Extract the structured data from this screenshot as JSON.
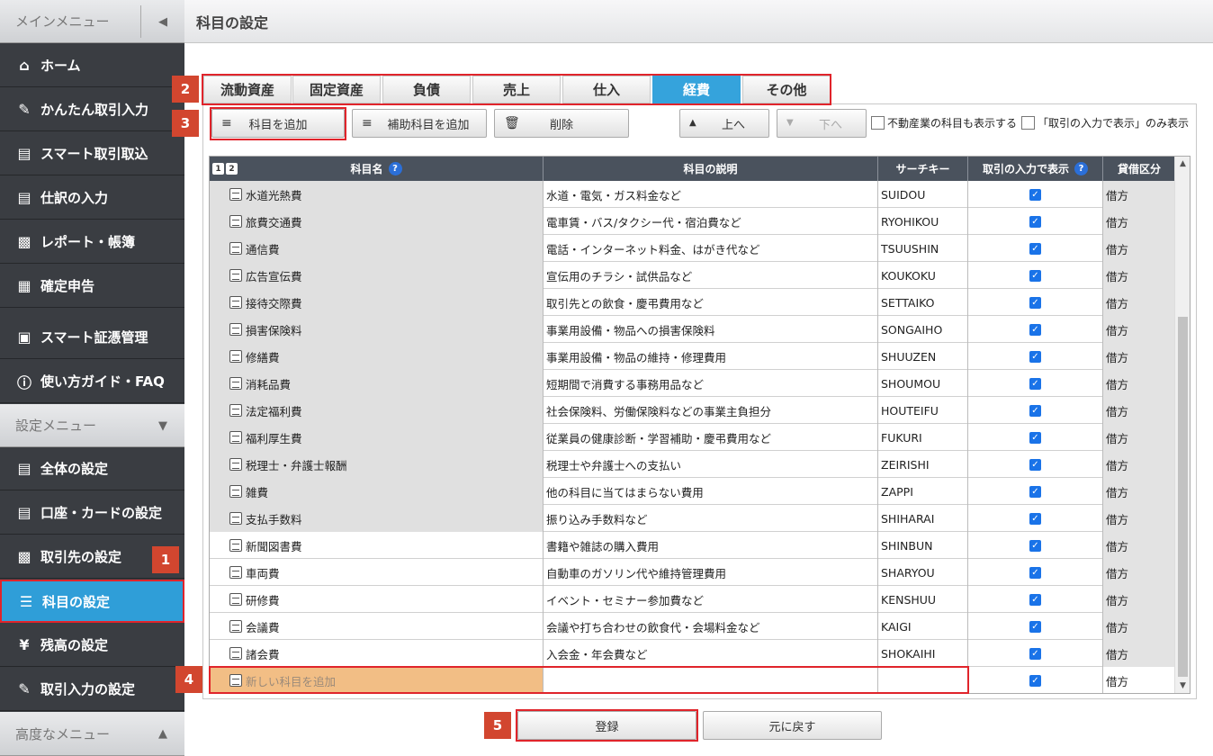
{
  "sidebar": {
    "main_menu_label": "メインメニュー",
    "settings_menu_label": "設定メニュー",
    "advanced_menu_label": "高度なメニュー",
    "main_items": [
      {
        "label": "ホーム",
        "icon": "home-icon"
      },
      {
        "label": "かんたん取引入力",
        "icon": "pencil-icon"
      },
      {
        "label": "スマート取引取込",
        "icon": "import-icon"
      },
      {
        "label": "仕訳の入力",
        "icon": "journal-icon"
      },
      {
        "label": "レポート・帳簿",
        "icon": "report-icon"
      },
      {
        "label": "確定申告",
        "icon": "tax-return-icon"
      },
      {
        "label": "スマート証憑管理",
        "icon": "voucher-icon"
      },
      {
        "label": "使い方ガイド・FAQ",
        "icon": "help-icon"
      }
    ],
    "settings_items": [
      {
        "label": "全体の設定",
        "icon": "settings-doc-icon"
      },
      {
        "label": "口座・カードの設定",
        "icon": "card-icon"
      },
      {
        "label": "取引先の設定",
        "icon": "partner-icon"
      },
      {
        "label": "科目の設定",
        "icon": "account-tree-icon"
      },
      {
        "label": "残高の設定",
        "icon": "yen-icon"
      },
      {
        "label": "取引入力の設定",
        "icon": "edit-settings-icon"
      }
    ]
  },
  "page": {
    "title": "科目の設定"
  },
  "tabs": [
    "流動資産",
    "固定資産",
    "負債",
    "売上",
    "仕入",
    "経費",
    "その他"
  ],
  "active_tab": "経費",
  "toolbar": {
    "add_account": "科目を追加",
    "add_sub_account": "補助科目を追加",
    "delete": "削除",
    "move_up": "上へ",
    "move_down": "下へ",
    "show_real_estate": "不動産業の科目も表示する",
    "show_only_input": "「取引の入力で表示」のみ表示"
  },
  "grid": {
    "pages": [
      "1",
      "2"
    ],
    "columns": [
      "科目名",
      "科目の説明",
      "サーチキー",
      "取引の入力で表示",
      "貸借区分"
    ],
    "rows": [
      {
        "name": "水道光熱費",
        "desc": "水道・電気・ガス料金など",
        "key": "SUIDOU",
        "type": "借方",
        "shaded": true
      },
      {
        "name": "旅費交通費",
        "desc": "電車賃・バス/タクシー代・宿泊費など",
        "key": "RYOHIKOU",
        "type": "借方",
        "shaded": true
      },
      {
        "name": "通信費",
        "desc": "電話・インターネット料金、はがき代など",
        "key": "TSUUSHIN",
        "type": "借方",
        "shaded": true
      },
      {
        "name": "広告宣伝費",
        "desc": "宣伝用のチラシ・試供品など",
        "key": "KOUKOKU",
        "type": "借方",
        "shaded": true
      },
      {
        "name": "接待交際費",
        "desc": "取引先との飲食・慶弔費用など",
        "key": "SETTAIKO",
        "type": "借方",
        "shaded": true
      },
      {
        "name": "損害保険料",
        "desc": "事業用設備・物品への損害保険料",
        "key": "SONGAIHO",
        "type": "借方",
        "shaded": true
      },
      {
        "name": "修繕費",
        "desc": "事業用設備・物品の維持・修理費用",
        "key": "SHUUZEN",
        "type": "借方",
        "shaded": true
      },
      {
        "name": "消耗品費",
        "desc": "短期間で消費する事務用品など",
        "key": "SHOUMOU",
        "type": "借方",
        "shaded": true
      },
      {
        "name": "法定福利費",
        "desc": "社会保険料、労働保険料などの事業主負担分",
        "key": "HOUTEIFU",
        "type": "借方",
        "shaded": true
      },
      {
        "name": "福利厚生費",
        "desc": "従業員の健康診断・学習補助・慶弔費用など",
        "key": "FUKURI",
        "type": "借方",
        "shaded": true
      },
      {
        "name": "税理士・弁護士報酬",
        "desc": "税理士や弁護士への支払い",
        "key": "ZEIRISHI",
        "type": "借方",
        "shaded": true
      },
      {
        "name": "雑費",
        "desc": "他の科目に当てはまらない費用",
        "key": "ZAPPI",
        "type": "借方",
        "shaded": true
      },
      {
        "name": "支払手数料",
        "desc": "振り込み手数料など",
        "key": "SHIHARAI",
        "type": "借方",
        "shaded": true
      },
      {
        "name": "新聞図書費",
        "desc": "書籍や雑誌の購入費用",
        "key": "SHINBUN",
        "type": "借方",
        "shaded": false
      },
      {
        "name": "車両費",
        "desc": "自動車のガソリン代や維持管理費用",
        "key": "SHARYOU",
        "type": "借方",
        "shaded": false
      },
      {
        "name": "研修費",
        "desc": "イベント・セミナー参加費など",
        "key": "KENSHUU",
        "type": "借方",
        "shaded": false
      },
      {
        "name": "会議費",
        "desc": "会議や打ち合わせの飲食代・会場料金など",
        "key": "KAIGI",
        "type": "借方",
        "shaded": false
      },
      {
        "name": "諸会費",
        "desc": "入会金・年会費など",
        "key": "SHOKAIHI",
        "type": "借方",
        "shaded": false
      }
    ],
    "new_row": {
      "name": "新しい科目を追加",
      "desc": "",
      "key": "",
      "type": "借方"
    }
  },
  "footer": {
    "save": "登録",
    "revert": "元に戻す"
  },
  "callouts": [
    "1",
    "2",
    "3",
    "4",
    "5"
  ],
  "colors": {
    "accent": "#2f9ed8",
    "highlight": "#e0242b",
    "callout": "#d2462f",
    "new_row": "#f2be85"
  }
}
